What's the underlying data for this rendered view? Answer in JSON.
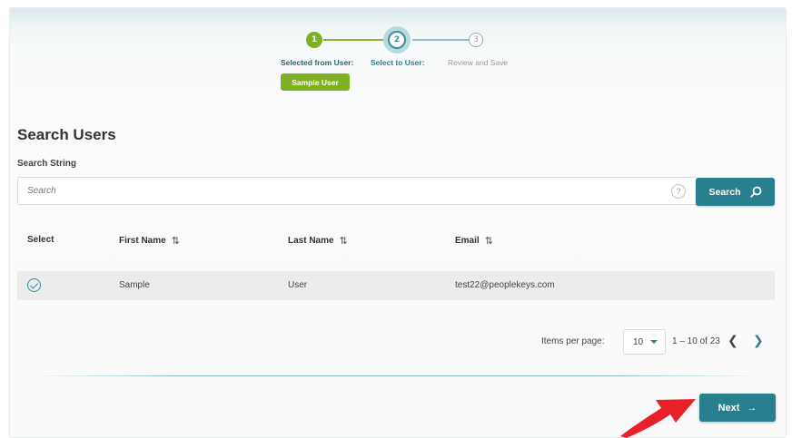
{
  "stepper": {
    "steps": [
      {
        "number": "1",
        "label": "Selected from User:",
        "state": "complete"
      },
      {
        "number": "2",
        "label": "Select to User:",
        "state": "current"
      },
      {
        "number": "3",
        "label": "Review and Save",
        "state": "pending"
      }
    ],
    "selected_chip": "Sample User"
  },
  "search": {
    "title": "Search Users",
    "field_label": "Search String",
    "placeholder": "Search",
    "help_icon": "?",
    "button_label": "Search"
  },
  "table": {
    "headers": {
      "select": "Select",
      "first_name": "First Name",
      "last_name": "Last Name",
      "email": "Email"
    },
    "sort_icon": "⇅",
    "rows": [
      {
        "selected": true,
        "first_name": "Sample",
        "last_name": "User",
        "email": "test22@peoplekeys.com"
      }
    ]
  },
  "paginator": {
    "items_per_page_label": "Items per page:",
    "page_size": "10",
    "range_label": "1 – 10 of 23"
  },
  "footer": {
    "next_label": "Next",
    "next_arrow": "→"
  },
  "colors": {
    "accent": "#2a7f8e",
    "step_complete": "#7fb022",
    "annotation_arrow": "#e8202a"
  }
}
